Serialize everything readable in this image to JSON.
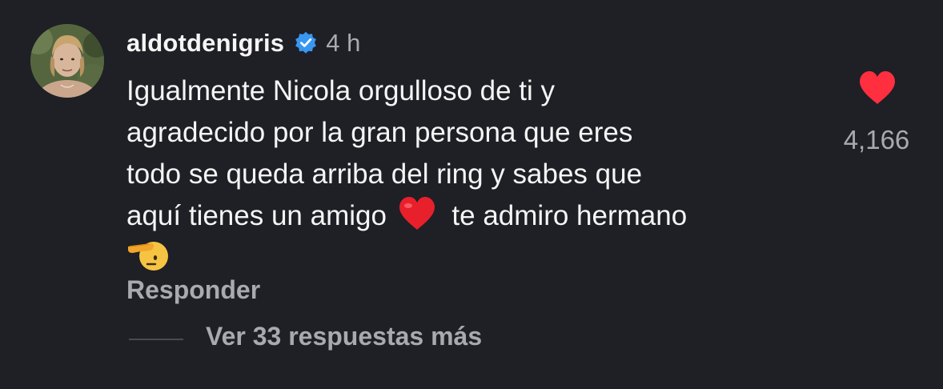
{
  "comment": {
    "username": "aldotdenigris",
    "time": "4 h",
    "text_lines": [
      "Igualmente Nicola orgulloso de ti y",
      "agradecido por la gran persona que eres",
      "todo se queda arriba del ring y sabes que"
    ],
    "line4_before": "aquí tienes un amigo",
    "line4_after": "te admiro hermano",
    "emojis": [
      "heart-emoji",
      "saluting-face-emoji"
    ]
  },
  "likes": {
    "count": "4,166",
    "liked": true,
    "heart_color": "#ff2f40"
  },
  "actions": {
    "reply_label": "Responder",
    "view_replies_label": "Ver 33 respuestas más"
  },
  "colors": {
    "background": "#1f1f26",
    "primary_text": "#f5f5f5",
    "secondary_text": "#a9a9b0",
    "verified_badge": "#3897f0"
  }
}
